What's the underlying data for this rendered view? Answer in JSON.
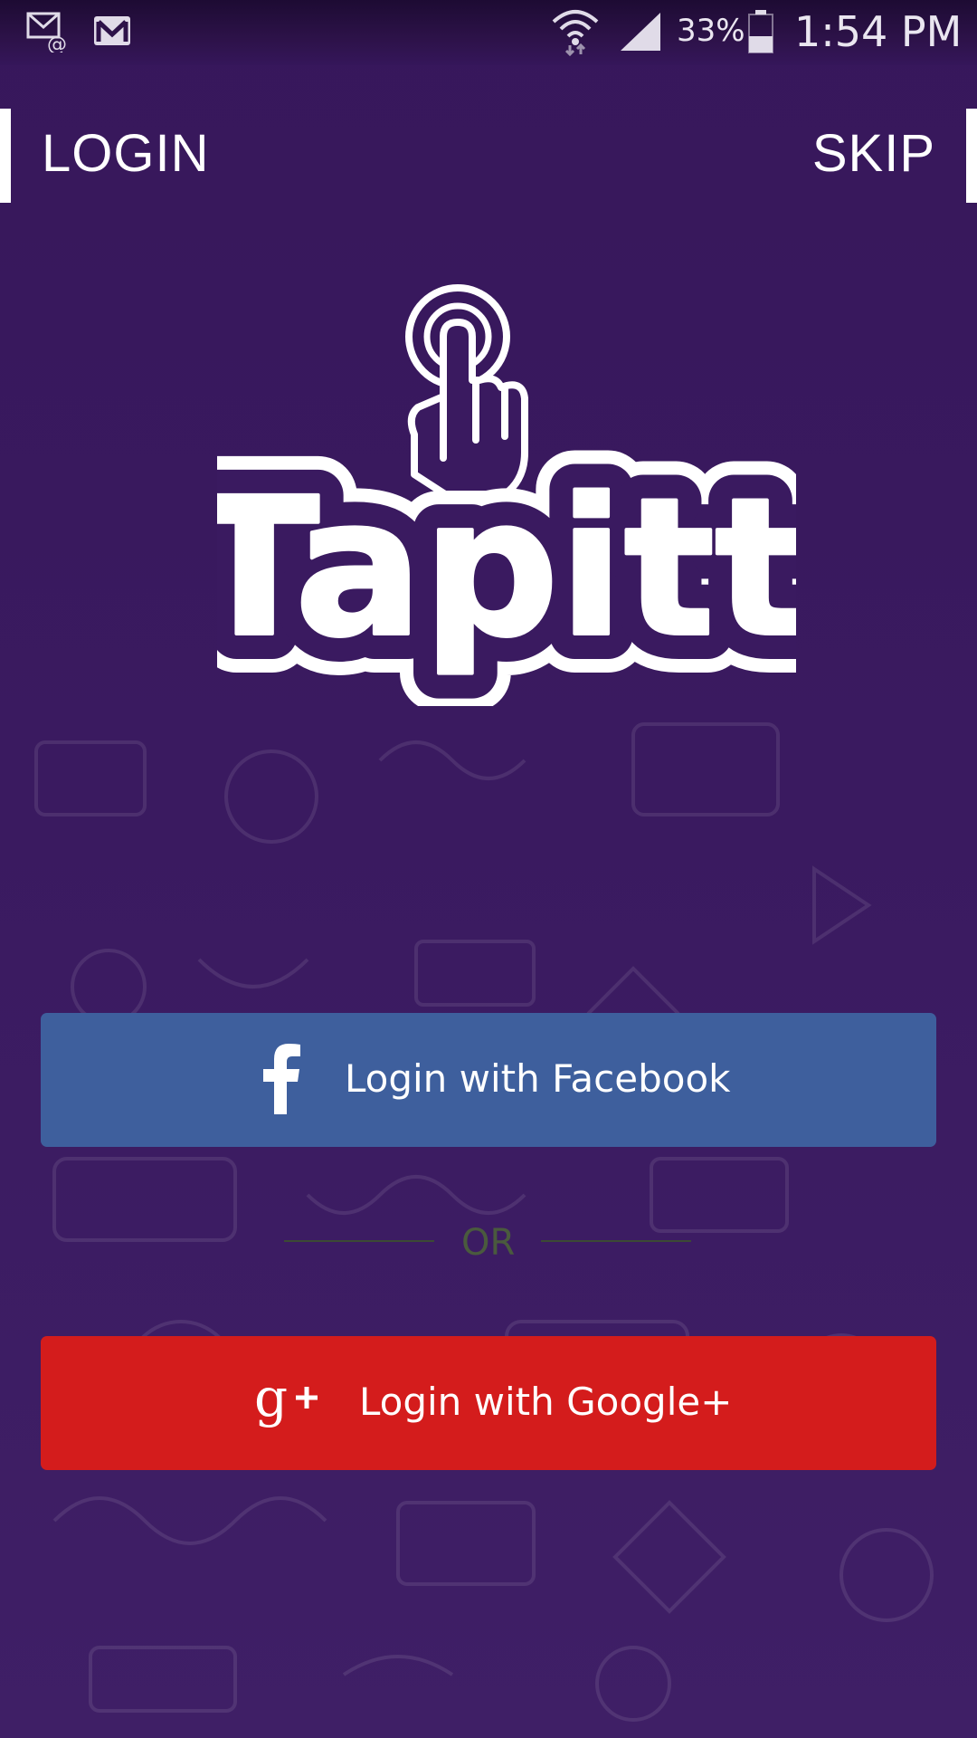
{
  "status_bar": {
    "icons": [
      "email-notification-icon",
      "gmail-icon",
      "wifi-icon",
      "signal-icon",
      "battery-icon"
    ],
    "battery_percent": "33%",
    "time": "1:54 PM"
  },
  "header": {
    "title": "LOGIN",
    "skip_label": "SKIP"
  },
  "logo": {
    "text": "Tapitt",
    "icon": "tap-hand-icon"
  },
  "buttons": {
    "facebook": {
      "label": "Login with Facebook",
      "icon": "facebook-icon",
      "color": "#3e5f9d"
    },
    "google": {
      "label": "Login with Google+",
      "icon": "google-plus-icon",
      "color": "#d41c1c"
    }
  },
  "divider": {
    "text": "OR"
  },
  "colors": {
    "background": "#3a1a60",
    "text": "#ffffff"
  }
}
